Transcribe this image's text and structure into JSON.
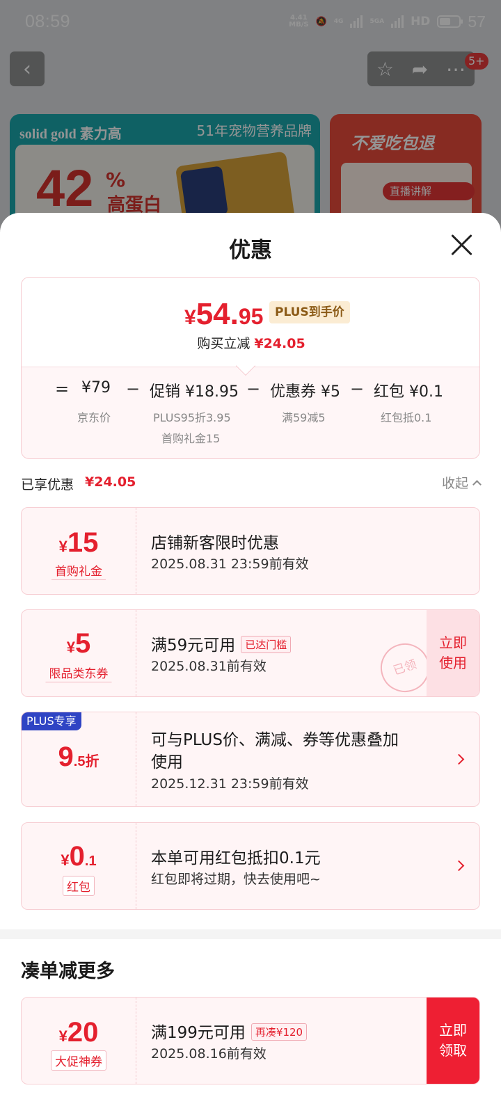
{
  "status_bar": {
    "time": "08:59",
    "net_speed_value": "4.41",
    "net_speed_unit": "MB/S",
    "signal_1": "4G",
    "signal_2": "5GA",
    "hd": "HD",
    "battery": "57"
  },
  "background_page": {
    "brand": "solid gold 素力高",
    "brand_slogan": "51年宠物营养品牌",
    "promo_percent": "42",
    "promo_percent_sign": "%",
    "promo_text": "高蛋白",
    "right_banner_title": "不爱吃包退",
    "live_badge": "直播讲解",
    "cart_badge": "5+"
  },
  "sheet": {
    "title": "优惠",
    "price_summary": {
      "currency": "¥",
      "price_int": "54.",
      "price_dec": "95",
      "plus_tag": "PLUS到手价",
      "reduce_label": "购买立减",
      "reduce_amount": "¥24.05"
    },
    "breakdown": {
      "eq": "=",
      "minus": "−",
      "base_value": "¥79",
      "base_label": "京东价",
      "promo_value": "促销 ¥18.95",
      "promo_sub1": "PLUS95折3.95",
      "promo_sub2": "首购礼金15",
      "coupon_value": "优惠券 ¥5",
      "coupon_sub": "满59减5",
      "redpack_value": "红包 ¥0.1",
      "redpack_sub": "红包抵0.1"
    },
    "enjoyed": {
      "label": "已享优惠",
      "amount": "¥24.05",
      "collapse": "收起"
    },
    "coupons": [
      {
        "yen": "¥",
        "amount": "15",
        "tag": "首购礼金",
        "title": "店铺新客限时优惠",
        "sub": "2025.08.31 23:59前有效"
      },
      {
        "yen": "¥",
        "amount": "5",
        "tag": "限品类东券",
        "title": "满59元可用",
        "badge": "已达门槛",
        "sub": "2025.08.31前有效",
        "action_1": "立即",
        "action_2": "使用",
        "stamp": "已领"
      },
      {
        "flag": "PLUS专享",
        "amount_big": "9",
        "amount_small": ".5折",
        "title_1": "可与PLUS价、满减、券等优惠叠加",
        "title_2": "使用",
        "sub": "2025.12.31 23:59前有效"
      },
      {
        "yen": "¥",
        "amount_big": "0",
        "amount_small": ".1",
        "tag": "红包",
        "title": "本单可用红包抵扣0.1元",
        "sub": "红包即将过期，快去使用吧~"
      }
    ],
    "more": {
      "title": "凑单减更多",
      "coupon": {
        "yen": "¥",
        "amount": "20",
        "tag": "大促神券",
        "title": "满199元可用",
        "badge": "再凑¥120",
        "sub": "2025.08.16前有效",
        "action_1": "立即",
        "action_2": "领取"
      }
    }
  }
}
